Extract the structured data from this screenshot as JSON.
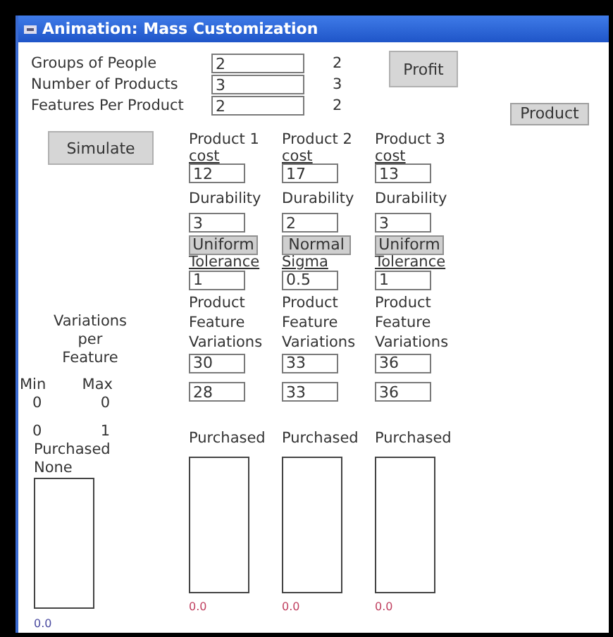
{
  "window": {
    "title": "Animation: Mass Customization"
  },
  "settings": [
    {
      "label": "Groups of People",
      "value": "2",
      "reading": "2"
    },
    {
      "label": "Number of Products",
      "value": "3",
      "reading": "3"
    },
    {
      "label": "Features Per Product",
      "value": "2",
      "reading": "2"
    }
  ],
  "profit_button": "Profit",
  "product_button": "Product",
  "simulate_button": "Simulate",
  "variations": {
    "title": "Variations per Feature",
    "min_label": "Min",
    "max_label": "Max",
    "rows": [
      {
        "min": "0",
        "max": "0"
      },
      {
        "min": "0",
        "max": "1"
      }
    ]
  },
  "purchased": {
    "label": "Purchased",
    "sublabel": "None",
    "value": "0.0"
  },
  "products": [
    {
      "title": "Product 1",
      "cost_label": "cost",
      "cost": "12",
      "durability_label": "Durability",
      "durability": "3",
      "distribution": "Uniform",
      "param_label": "Tolerance",
      "param": "1",
      "variations_label": "Product Feature Variations",
      "variations": [
        "30",
        "28"
      ],
      "purchased_label": "Purchased",
      "purchased_value": "0.0"
    },
    {
      "title": "Product 2",
      "cost_label": "cost",
      "cost": "17",
      "durability_label": "Durability",
      "durability": "2",
      "distribution": "Normal",
      "param_label": "Sigma",
      "param": "0.5",
      "variations_label": "Product Feature Variations",
      "variations": [
        "33",
        "33"
      ],
      "purchased_label": "Purchased",
      "purchased_value": "0.0"
    },
    {
      "title": "Product 3",
      "cost_label": "cost",
      "cost": "13",
      "durability_label": "Durability",
      "durability": "3",
      "distribution": "Uniform",
      "param_label": "Tolerance",
      "param": "1",
      "variations_label": "Product Feature Variations",
      "variations": [
        "36",
        "36"
      ],
      "purchased_label": "Purchased",
      "purchased_value": "0.0"
    }
  ]
}
